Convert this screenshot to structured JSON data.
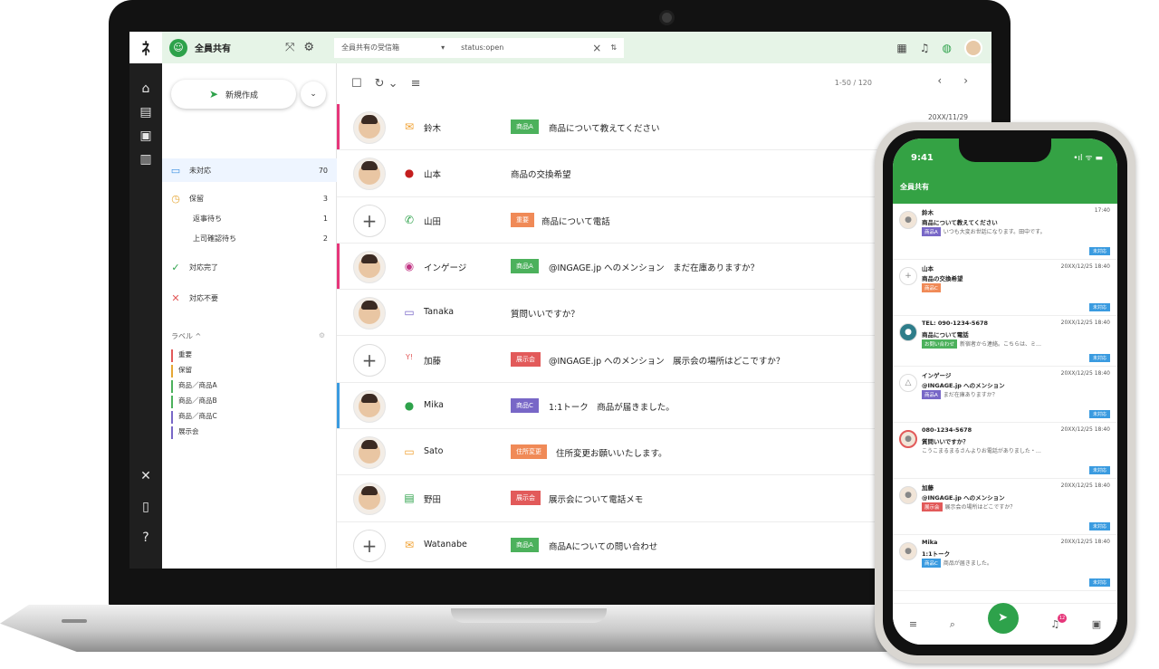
{
  "app": {
    "logo_text": "ﾈ",
    "inbox_badge": "☺",
    "inbox_name": "全員共有"
  },
  "topbar": {
    "filter_select": "全員共有の受信箱",
    "filter_query": "status:open"
  },
  "sidebar": {
    "new_button": "新規作成",
    "items": [
      {
        "label": "未対応",
        "count": "70"
      },
      {
        "label": "保留",
        "count": "3"
      },
      {
        "label": "返事待ち",
        "count": "1"
      },
      {
        "label": "上司確認待ち",
        "count": "2"
      },
      {
        "label": "対応完了",
        "count": ""
      },
      {
        "label": "対応不要",
        "count": ""
      }
    ],
    "labels_heading": "ラベル ^",
    "labels": [
      "重要",
      "保留",
      "商品／商品A",
      "商品／商品B",
      "商品／商品C",
      "展示会"
    ]
  },
  "list": {
    "pager": "1-50 / 120",
    "date": "20XX/11/29",
    "rows": [
      {
        "name": "鈴木",
        "tag": "商品A",
        "subject": "商品について教えてください"
      },
      {
        "name": "山本",
        "tag": "",
        "subject": "商品の交換希望"
      },
      {
        "name": "山田",
        "tag": "重要",
        "subject": "商品について電話"
      },
      {
        "name": "インゲージ",
        "tag": "商品A",
        "subject": "@INGAGE.jp へのメンション　まだ在庫ありますか？"
      },
      {
        "name": "Tanaka",
        "tag": "",
        "subject": "質問いいですか？"
      },
      {
        "name": "加藤",
        "tag": "展示会",
        "subject": "@INGAGE.jp へのメンション　展示会の場所はどこですか？"
      },
      {
        "name": "Mika",
        "tag": "商品C",
        "subject": "1:1トーク　商品が届きました。"
      },
      {
        "name": "Sato",
        "tag": "住所変更",
        "subject": "住所変更お願いいたします。"
      },
      {
        "name": "野田",
        "tag": "展示会",
        "subject": "展示会について電話メモ"
      },
      {
        "name": "Watanabe",
        "tag": "商品A",
        "subject": "商品Aについての問い合わせ"
      }
    ]
  },
  "phone": {
    "time": "9:41",
    "status_icons": "•ıl ᯤ ▬",
    "title": "全員共有",
    "status_label": "未対応",
    "bell_count": "12",
    "items": [
      {
        "l1": "鈴木",
        "l2": "商品について教えてください",
        "tag": "商品A",
        "l3": "いつも大変お世話になります。田中です。",
        "time": "17:40"
      },
      {
        "l1": "山本",
        "l2": "商品の交換希望",
        "tag": "商品C",
        "l3": "",
        "time": "20XX/12/25 18:40"
      },
      {
        "l1": "TEL: 090-1234-5678",
        "l2": "商品について電話",
        "tag": "お問い合わせ",
        "l3": "新宿者から連絡。こちらは、ミ…",
        "time": "20XX/12/25 18:40"
      },
      {
        "l1": "インゲージ",
        "l2": "@INGAGE.jp へのメンション",
        "tag": "商品A",
        "l3": "まだ在庫ありますか？",
        "time": "20XX/12/25 18:40"
      },
      {
        "l1": "080-1234-5678",
        "l2": "質問いいですか？",
        "tag": "",
        "l3": "こうこまるまるさんよりお電話がありました・…",
        "time": "20XX/12/25 18:40"
      },
      {
        "l1": "加藤",
        "l2": "@INGAGE.jp へのメンション",
        "tag": "展示会",
        "l3": "展示会の場所はどこですか？",
        "time": "20XX/12/25 18:40"
      },
      {
        "l1": "Mika",
        "l2": "1:1トーク",
        "tag": "商品C",
        "l3": "商品が届きました。",
        "time": "20XX/12/25 18:40"
      }
    ]
  },
  "colors": {
    "brand_green": "#2ea24b",
    "tag_green": "#4cb15c",
    "tag_red": "#e25a5a",
    "tag_purple": "#7867c7",
    "tag_orange": "#f08a57",
    "status_blue": "#3a9be0"
  }
}
